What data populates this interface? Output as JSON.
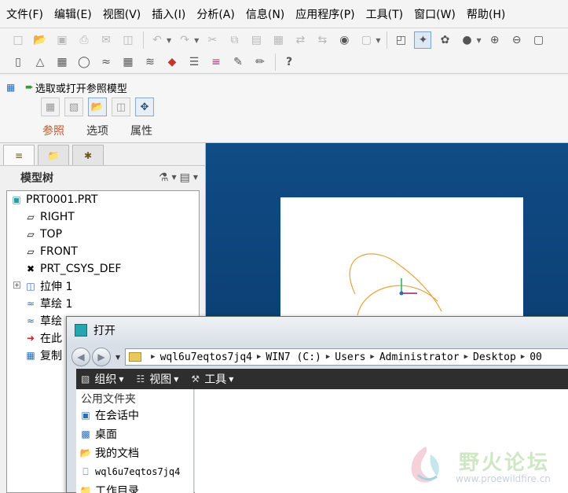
{
  "menubar": {
    "items": [
      "文件(F)",
      "编辑(E)",
      "视图(V)",
      "插入(I)",
      "分析(A)",
      "信息(N)",
      "应用程序(P)",
      "工具(T)",
      "窗口(W)",
      "帮助(H)"
    ]
  },
  "toolbar": {
    "row1_icons": [
      "new-icon",
      "open-icon",
      "save-icon",
      "print-icon",
      "send-icon",
      "copy-icon",
      "undo-icon",
      "redo-icon",
      "cut-icon",
      "copy-icon",
      "paste-icon",
      "paste-special-icon",
      "mirror-icon",
      "mirror-icon",
      "find-icon",
      "select-box-icon",
      "repaint-icon",
      "spin-center-icon",
      "orient-icon",
      "shade-icon",
      "zoom-in-icon",
      "zoom-out-icon",
      "refit-icon"
    ],
    "row2_icons": [
      "datum-plane-icon",
      "datum-axis-icon",
      "datum-curve-icon",
      "datum-point-icon",
      "csys-icon",
      "analysis-icon",
      "annotation-icon",
      "color-icon",
      "layer-icon",
      "view-manager-icon",
      "sketch-icon",
      "whats-this-icon"
    ]
  },
  "dashboard": {
    "title": "选取或打开参照模型",
    "tabs": [
      "参照",
      "选项",
      "属性"
    ],
    "active_tab": "参照"
  },
  "sidebar": {
    "title": "模型树",
    "tree": [
      {
        "label": "PRT0001.PRT",
        "icon": "part-icon"
      },
      {
        "label": "RIGHT",
        "icon": "datum-plane-icon"
      },
      {
        "label": "TOP",
        "icon": "datum-plane-icon"
      },
      {
        "label": "FRONT",
        "icon": "datum-plane-icon"
      },
      {
        "label": "PRT_CSYS_DEF",
        "icon": "csys-icon"
      },
      {
        "label": "拉伸 1",
        "icon": "extrude-icon"
      },
      {
        "label": "草绘 1",
        "icon": "sketch-icon"
      },
      {
        "label": "草绘",
        "icon": "sketch-icon"
      },
      {
        "label": "在此",
        "icon": "insert-here-icon"
      },
      {
        "label": "复制",
        "icon": "copy-feature-icon"
      }
    ]
  },
  "dialog": {
    "title": "打开",
    "path": [
      "wql6u7eqtos7jq4",
      "WIN7 (C:)",
      "Users",
      "Administrator",
      "Desktop",
      "00"
    ],
    "toolbar": {
      "organize": "组织",
      "views": "视图",
      "tools": "工具"
    },
    "favorites_header": "公用文件夹",
    "favorites": [
      {
        "label": "在会话中",
        "icon": "session-icon"
      },
      {
        "label": "桌面",
        "icon": "desktop-icon"
      },
      {
        "label": "我的文档",
        "icon": "my-documents-icon"
      },
      {
        "label": "wql6u7eqtos7jq4",
        "icon": "computer-icon"
      },
      {
        "label": "工作目录",
        "icon": "working-directory-icon"
      }
    ]
  },
  "watermark": {
    "text": "野火论坛",
    "url": "www.proewildfire.cn"
  },
  "colors": {
    "graphics_bg": "#0d467d",
    "curve": "#e7a33c",
    "active_tab": "#c8552a"
  }
}
